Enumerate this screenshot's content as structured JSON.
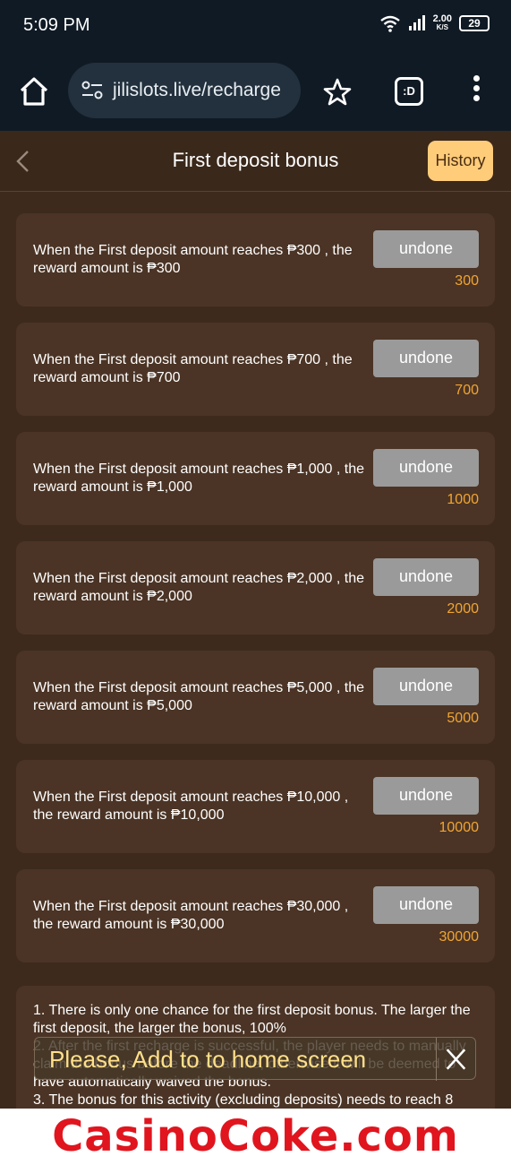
{
  "status": {
    "time": "5:09 PM",
    "net_speed_value": "2.00",
    "net_speed_unit": "K/S",
    "battery": "29"
  },
  "browser": {
    "url": "jilislots.live/recharge",
    "tab_label": ":D"
  },
  "header": {
    "title": "First deposit bonus",
    "history_label": "History"
  },
  "bonuses": [
    {
      "text": "When the First deposit amount reaches ₱300 , the reward amount is ₱300",
      "button": "undone",
      "amount": "300"
    },
    {
      "text": "When the First deposit amount reaches ₱700 , the reward amount is ₱700",
      "button": "undone",
      "amount": "700"
    },
    {
      "text": "When the First deposit amount reaches ₱1,000 , the reward amount is ₱1,000",
      "button": "undone",
      "amount": "1000"
    },
    {
      "text": "When the First deposit amount reaches ₱2,000 , the reward amount is ₱2,000",
      "button": "undone",
      "amount": "2000"
    },
    {
      "text": "When the First deposit amount reaches ₱5,000 , the reward amount is ₱5,000",
      "button": "undone",
      "amount": "5000"
    },
    {
      "text": "When the First deposit amount reaches ₱10,000 , the reward amount is ₱10,000",
      "button": "undone",
      "amount": "10000"
    },
    {
      "text": "When the First deposit amount reaches ₱30,000 , the reward amount is ₱30,000",
      "button": "undone",
      "amount": "30000"
    }
  ],
  "rules": {
    "line1": "1. There is only one chance for the first deposit bonus. The larger the first deposit, the larger the bonus, 100%",
    "line2": "2. After the first recharge is successful, the player needs to manually claim the bonus before the deadline, otherwise it will be deemed to have automatically waived the bonus.",
    "line3": "3. The bonus for this activity (excluding deposits) needs to reach 8"
  },
  "toast": {
    "message": "Please, Add to to home screen"
  },
  "watermark": "CasinoCoke.com",
  "colors": {
    "background": "#3d2a1d",
    "card": "#4b3425",
    "accent_amount": "#f2a531",
    "history_button": "#ffcc7a",
    "undone_button": "#9a9a9a",
    "watermark": "#e0151e"
  }
}
